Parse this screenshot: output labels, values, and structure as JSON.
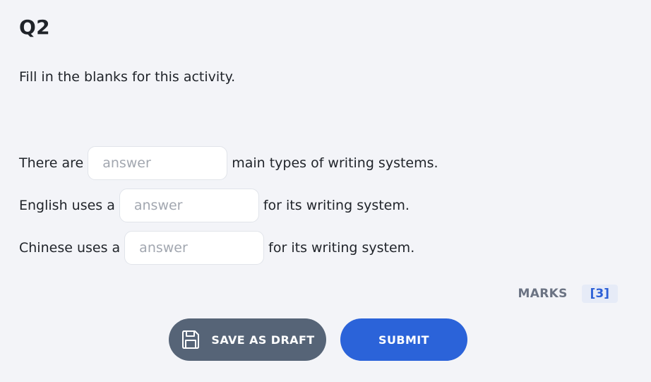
{
  "question": {
    "title": "Q2",
    "instructions": "Fill in the blanks for this activity."
  },
  "blanks": [
    {
      "before": "There are",
      "placeholder": "answer",
      "value": "",
      "after": "main types of writing systems."
    },
    {
      "before": "English uses a",
      "placeholder": "answer",
      "value": "",
      "after": "for its writing system."
    },
    {
      "before": "Chinese uses a",
      "placeholder": "answer",
      "value": "",
      "after": "for its writing system."
    }
  ],
  "marks": {
    "label": "MARKS",
    "value": "[3]"
  },
  "actions": {
    "save_draft_label": "SAVE AS DRAFT",
    "save_draft_icon": "floppy-disk-icon",
    "submit_label": "SUBMIT"
  },
  "colors": {
    "background": "#f3f4f8",
    "draft_button": "#566477",
    "submit_button": "#2b63d9",
    "marks_badge_text": "#2c5fd6"
  }
}
